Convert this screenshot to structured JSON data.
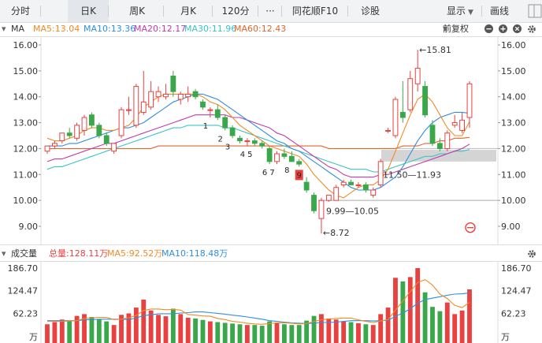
{
  "tabs": {
    "items": [
      {
        "label": "分时"
      },
      {
        "label": "日K"
      },
      {
        "label": "周K"
      },
      {
        "label": "月K"
      },
      {
        "label": "120分"
      },
      {
        "label": "···"
      },
      {
        "label": "同花顺F10"
      },
      {
        "label": "诊股"
      }
    ],
    "active_index": 1,
    "display_label": "显示",
    "draw_label": "画线"
  },
  "price_panel": {
    "indicator_label": "MA",
    "ma5": "MA5:13.04",
    "ma10": "MA10:13.36",
    "ma20": "MA20:12.17",
    "ma30": "MA30:11.96",
    "ma60": "MA60:12.43",
    "adjust_label": "前复权",
    "y_ticks": [
      "16.00",
      "15.00",
      "14.00",
      "13.00",
      "12.00",
      "11.00",
      "10.00",
      "9.00"
    ],
    "high_annotation": "←15.81",
    "low_annotation": "←8.72",
    "range1_label": "11.50—11.93",
    "range2_label": "9.99—10.05",
    "count_labels": [
      "1",
      "2",
      "3",
      "4",
      "5",
      "6",
      "7",
      "8",
      "9"
    ]
  },
  "volume_panel": {
    "title": "成交量",
    "total": "总量:128.11万",
    "ma5": "MA5:92.52万",
    "ma10": "MA10:118.48万",
    "y_ticks": [
      "186.70",
      "124.47",
      "62.23"
    ],
    "unit": "万"
  },
  "colors": {
    "up": "#e8413f",
    "down": "#3aa84a",
    "ma5": "#f08a24",
    "ma10": "#2f8fe0",
    "ma20": "#c03cae",
    "ma30": "#3cc3c8",
    "ma60": "#e2652e"
  },
  "chart_data": {
    "type": "candlestick",
    "price_ylim": [
      8.5,
      16.3
    ],
    "volume_ylim": [
      0,
      200
    ],
    "candles": [
      {
        "o": 11.9,
        "h": 12.1,
        "l": 11.8,
        "c": 12.1
      },
      {
        "o": 12.1,
        "h": 12.3,
        "l": 12.0,
        "c": 12.2
      },
      {
        "o": 12.3,
        "h": 12.6,
        "l": 12.2,
        "c": 12.6
      },
      {
        "o": 12.6,
        "h": 12.8,
        "l": 12.4,
        "c": 12.5
      },
      {
        "o": 12.4,
        "h": 13.0,
        "l": 12.3,
        "c": 12.9
      },
      {
        "o": 12.7,
        "h": 13.3,
        "l": 12.5,
        "c": 13.2
      },
      {
        "o": 13.3,
        "h": 13.4,
        "l": 12.8,
        "c": 12.9
      },
      {
        "o": 12.9,
        "h": 13.0,
        "l": 12.4,
        "c": 12.5
      },
      {
        "o": 12.5,
        "h": 12.6,
        "l": 12.1,
        "c": 12.2
      },
      {
        "o": 11.9,
        "h": 12.2,
        "l": 11.8,
        "c": 12.2
      },
      {
        "o": 12.5,
        "h": 13.6,
        "l": 12.4,
        "c": 13.5
      },
      {
        "o": 13.5,
        "h": 14.0,
        "l": 13.3,
        "c": 13.5
      },
      {
        "o": 12.9,
        "h": 14.5,
        "l": 12.8,
        "c": 14.4
      },
      {
        "o": 13.4,
        "h": 15.0,
        "l": 13.3,
        "c": 13.8
      },
      {
        "o": 13.6,
        "h": 14.6,
        "l": 13.5,
        "c": 14.2
      },
      {
        "o": 14.0,
        "h": 14.4,
        "l": 13.8,
        "c": 14.2
      },
      {
        "o": 14.0,
        "h": 14.5,
        "l": 13.9,
        "c": 14.1
      },
      {
        "o": 14.8,
        "h": 15.0,
        "l": 14.0,
        "c": 14.2
      },
      {
        "o": 13.9,
        "h": 14.2,
        "l": 13.7,
        "c": 14.1
      },
      {
        "o": 14.0,
        "h": 14.4,
        "l": 13.8,
        "c": 14.1
      },
      {
        "o": 14.2,
        "h": 14.3,
        "l": 13.9,
        "c": 14.0
      },
      {
        "o": 13.8,
        "h": 13.9,
        "l": 13.5,
        "c": 13.6
      },
      {
        "o": 13.5,
        "h": 13.6,
        "l": 13.2,
        "c": 13.5
      },
      {
        "o": 13.5,
        "h": 13.7,
        "l": 13.1,
        "c": 13.2
      },
      {
        "o": 13.2,
        "h": 13.3,
        "l": 12.7,
        "c": 12.8
      },
      {
        "o": 12.8,
        "h": 12.9,
        "l": 12.4,
        "c": 12.5
      },
      {
        "o": 12.4,
        "h": 12.5,
        "l": 12.2,
        "c": 12.3
      },
      {
        "o": 12.3,
        "h": 12.4,
        "l": 12.1,
        "c": 12.3
      },
      {
        "o": 12.3,
        "h": 12.4,
        "l": 12.1,
        "c": 12.2
      },
      {
        "o": 12.2,
        "h": 12.3,
        "l": 12.0,
        "c": 12.1
      },
      {
        "o": 12.0,
        "h": 12.1,
        "l": 11.4,
        "c": 11.5
      },
      {
        "o": 11.5,
        "h": 11.9,
        "l": 11.4,
        "c": 11.8
      },
      {
        "o": 11.8,
        "h": 12.0,
        "l": 11.6,
        "c": 11.7
      },
      {
        "o": 11.7,
        "h": 11.9,
        "l": 11.5,
        "c": 11.5
      },
      {
        "o": 11.5,
        "h": 11.6,
        "l": 11.3,
        "c": 11.4
      },
      {
        "o": 10.7,
        "h": 10.9,
        "l": 10.3,
        "c": 10.4
      },
      {
        "o": 10.2,
        "h": 10.3,
        "l": 9.5,
        "c": 9.6
      },
      {
        "o": 9.3,
        "h": 10.1,
        "l": 8.72,
        "c": 10.0
      },
      {
        "o": 10.0,
        "h": 10.2,
        "l": 9.95,
        "c": 10.2
      },
      {
        "o": 10.0,
        "h": 10.6,
        "l": 9.99,
        "c": 10.5
      },
      {
        "o": 10.6,
        "h": 10.8,
        "l": 10.5,
        "c": 10.7
      },
      {
        "o": 10.7,
        "h": 10.8,
        "l": 10.6,
        "c": 10.6
      },
      {
        "o": 10.6,
        "h": 10.7,
        "l": 10.5,
        "c": 10.6
      },
      {
        "o": 10.6,
        "h": 10.7,
        "l": 10.3,
        "c": 10.4
      },
      {
        "o": 10.2,
        "h": 10.5,
        "l": 10.1,
        "c": 10.4
      },
      {
        "o": 10.6,
        "h": 11.6,
        "l": 10.5,
        "c": 11.5
      },
      {
        "o": 12.7,
        "h": 12.8,
        "l": 12.6,
        "c": 12.7
      },
      {
        "o": 12.5,
        "h": 14.0,
        "l": 12.4,
        "c": 13.9
      },
      {
        "o": 13.4,
        "h": 14.6,
        "l": 13.0,
        "c": 13.2
      },
      {
        "o": 13.5,
        "h": 15.0,
        "l": 13.4,
        "c": 14.7
      },
      {
        "o": 14.5,
        "h": 15.81,
        "l": 14.2,
        "c": 15.1
      },
      {
        "o": 14.4,
        "h": 14.6,
        "l": 13.2,
        "c": 13.3
      },
      {
        "o": 12.9,
        "h": 13.1,
        "l": 12.1,
        "c": 12.2
      },
      {
        "o": 12.2,
        "h": 12.4,
        "l": 11.9,
        "c": 12.0
      },
      {
        "o": 12.0,
        "h": 12.7,
        "l": 11.9,
        "c": 12.6
      },
      {
        "o": 12.9,
        "h": 13.3,
        "l": 12.8,
        "c": 13.0
      },
      {
        "o": 12.7,
        "h": 13.4,
        "l": 12.6,
        "c": 13.1
      },
      {
        "o": 13.2,
        "h": 14.6,
        "l": 12.8,
        "c": 14.5
      }
    ],
    "volumes": [
      32,
      38,
      45,
      42,
      55,
      60,
      52,
      46,
      40,
      30,
      58,
      62,
      78,
      100,
      70,
      58,
      54,
      75,
      60,
      50,
      48,
      44,
      40,
      38,
      36,
      34,
      32,
      30,
      30,
      28,
      40,
      35,
      32,
      30,
      30,
      42,
      55,
      60,
      48,
      45,
      40,
      38,
      35,
      32,
      30,
      60,
      78,
      160,
      150,
      162,
      186.7,
      120,
      80,
      68,
      92,
      60,
      70,
      128.11
    ],
    "ma_price": {
      "ma5": [
        12.4,
        12.3,
        12.3,
        12.4,
        12.5,
        12.7,
        12.8,
        12.8,
        12.7,
        12.7,
        12.8,
        12.9,
        13.2,
        13.6,
        13.8,
        14.0,
        14.1,
        14.1,
        14.1,
        14.1,
        14.1,
        14.0,
        13.8,
        13.7,
        13.5,
        13.2,
        12.9,
        12.7,
        12.5,
        12.3,
        12.1,
        12.0,
        11.9,
        11.8,
        11.7,
        11.4,
        11.0,
        10.7,
        10.4,
        10.2,
        10.1,
        10.3,
        10.5,
        10.6,
        10.6,
        10.8,
        11.2,
        11.9,
        12.6,
        13.3,
        13.9,
        14.1,
        13.8,
        13.3,
        12.8,
        12.5,
        12.5,
        13.04
      ],
      "ma10": [
        12.1,
        12.1,
        12.1,
        12.2,
        12.2,
        12.3,
        12.4,
        12.5,
        12.6,
        12.7,
        12.8,
        12.8,
        12.9,
        13.0,
        13.2,
        13.4,
        13.6,
        13.8,
        13.9,
        14.0,
        14.1,
        14.1,
        14.0,
        13.9,
        13.7,
        13.5,
        13.3,
        13.1,
        12.9,
        12.7,
        12.5,
        12.3,
        12.2,
        12.0,
        11.9,
        11.7,
        11.5,
        11.3,
        11.1,
        10.9,
        10.7,
        10.5,
        10.4,
        10.4,
        10.4,
        10.5,
        10.7,
        10.9,
        11.3,
        11.8,
        12.3,
        12.7,
        13.0,
        13.2,
        13.3,
        13.4,
        13.4,
        13.36
      ],
      "ma20": [
        11.5,
        11.6,
        11.6,
        11.7,
        11.8,
        11.9,
        12.0,
        12.1,
        12.2,
        12.2,
        12.3,
        12.4,
        12.5,
        12.6,
        12.7,
        12.8,
        12.9,
        13.0,
        13.1,
        13.2,
        13.3,
        13.3,
        13.3,
        13.3,
        13.3,
        13.2,
        13.2,
        13.1,
        13.0,
        12.9,
        12.8,
        12.6,
        12.5,
        12.3,
        12.1,
        11.9,
        11.7,
        11.5,
        11.3,
        11.2,
        11.0,
        10.9,
        10.9,
        10.9,
        10.9,
        11.0,
        11.0,
        11.1,
        11.2,
        11.3,
        11.4,
        11.5,
        11.6,
        11.7,
        11.8,
        11.9,
        12.0,
        12.17
      ],
      "ma30": [
        11.2,
        11.3,
        11.3,
        11.4,
        11.5,
        11.6,
        11.7,
        11.8,
        11.9,
        12.0,
        12.1,
        12.2,
        12.3,
        12.4,
        12.5,
        12.6,
        12.7,
        12.8,
        12.8,
        12.9,
        12.9,
        12.9,
        12.9,
        12.9,
        12.8,
        12.8,
        12.7,
        12.6,
        12.5,
        12.4,
        12.3,
        12.2,
        12.1,
        12.0,
        11.9,
        11.8,
        11.7,
        11.6,
        11.5,
        11.4,
        11.3,
        11.2,
        11.2,
        11.2,
        11.1,
        11.1,
        11.2,
        11.3,
        11.4,
        11.5,
        11.6,
        11.7,
        11.7,
        11.8,
        11.8,
        11.9,
        11.9,
        11.96
      ],
      "ma60": [
        12.0,
        12.0,
        12.0,
        12.0,
        12.0,
        12.0,
        12.0,
        12.0,
        12.0,
        12.0,
        12.0,
        12.0,
        12.0,
        12.0,
        12.0,
        12.1,
        12.1,
        12.1,
        12.1,
        12.1,
        12.1,
        12.1,
        12.1,
        12.1,
        12.1,
        12.1,
        12.1,
        12.1,
        12.1,
        12.1,
        12.1,
        12.1,
        12.1,
        12.1,
        12.1,
        12.1,
        12.1,
        12.1,
        12.0,
        12.0,
        12.0,
        12.0,
        12.0,
        12.0,
        12.0,
        12.0,
        12.0,
        12.0,
        12.1,
        12.1,
        12.1,
        12.2,
        12.2,
        12.3,
        12.3,
        12.4,
        12.4,
        12.43
      ]
    },
    "ma_volume": {
      "ma5": [
        40,
        40,
        40,
        41,
        42,
        48,
        50,
        51,
        51,
        45,
        46,
        50,
        56,
        70,
        74,
        74,
        72,
        73,
        71,
        59,
        57,
        55,
        54,
        48,
        45,
        40,
        38,
        35,
        33,
        32,
        34,
        36,
        36,
        35,
        33,
        34,
        40,
        44,
        47,
        48,
        49,
        49,
        44,
        40,
        37,
        41,
        45,
        71,
        96,
        122,
        147,
        155,
        140,
        115,
        103,
        84,
        78,
        92.52
      ],
      "ma10": [
        42,
        42,
        42,
        42,
        42,
        44,
        45,
        46,
        46,
        46,
        46,
        45,
        49,
        56,
        58,
        61,
        61,
        61,
        63,
        64,
        66,
        66,
        64,
        62,
        60,
        57,
        55,
        52,
        49,
        46,
        42,
        40,
        38,
        36,
        35,
        34,
        35,
        37,
        37,
        38,
        40,
        42,
        42,
        42,
        41,
        42,
        43,
        54,
        63,
        75,
        90,
        100,
        104,
        108,
        112,
        115,
        116,
        118.48
      ]
    },
    "horizontal_bands": [
      {
        "from": 11.5,
        "to": 11.93
      },
      {
        "from": 9.99,
        "to": 10.05
      }
    ]
  }
}
